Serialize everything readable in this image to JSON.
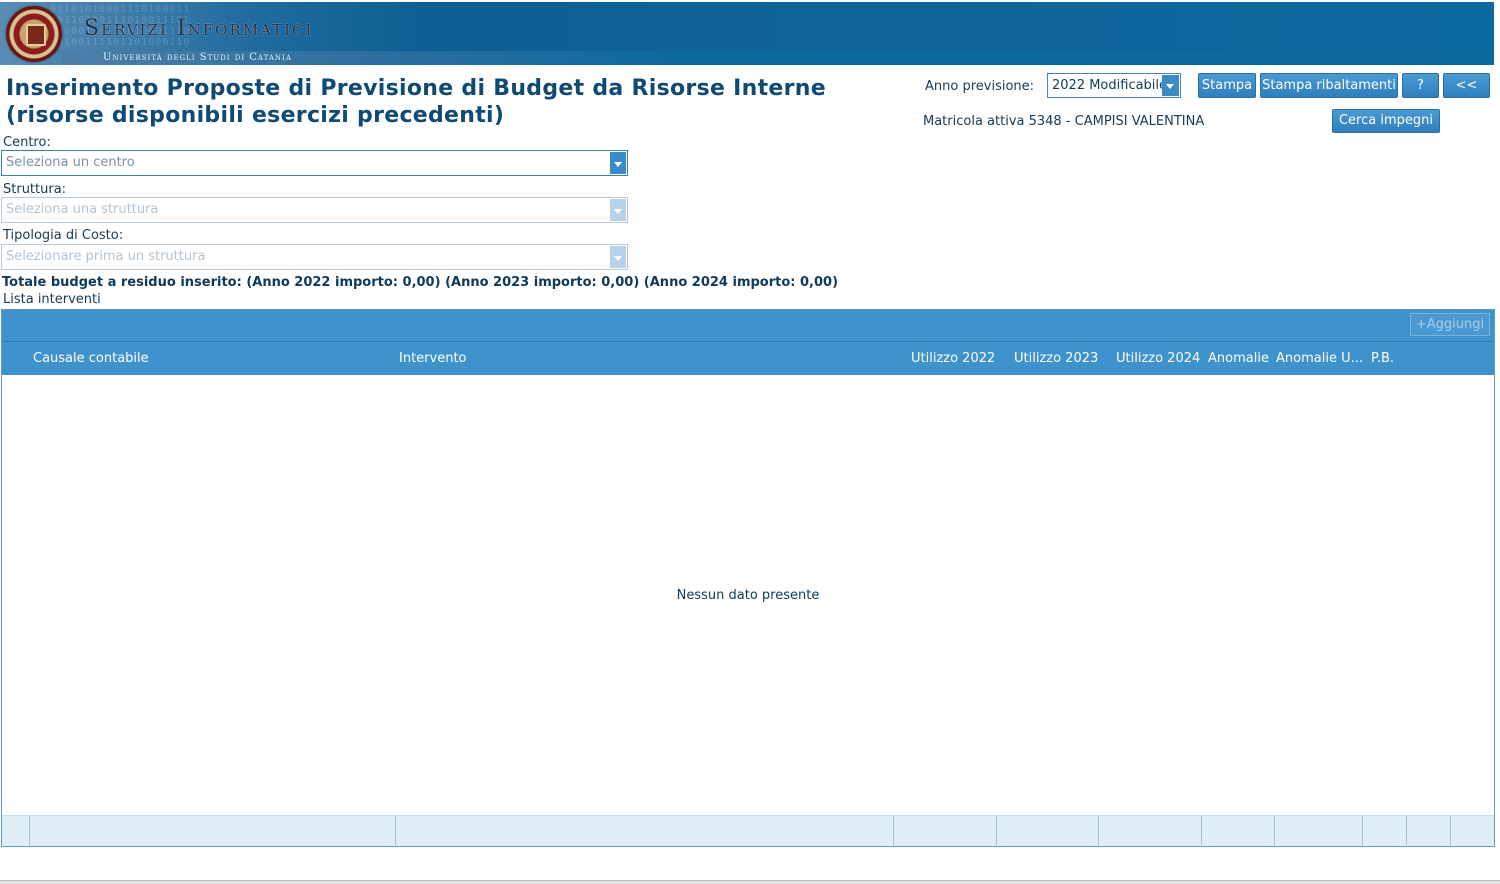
{
  "banner": {
    "title": "Servizi Informatici",
    "subtitle": "Università degli Studi di Catania",
    "logo": "university-seal"
  },
  "page": {
    "title": "Inserimento Proposte di Previsione di Budget da Risorse Interne (risorse disponibili esercizi precedenti)"
  },
  "anno": {
    "label": "Anno previsione:",
    "selected": "2022 Modificabile"
  },
  "toolbar": {
    "stampa": "Stampa",
    "stampa_ribaltamenti": "Stampa ribaltamenti",
    "help": "?",
    "back": "<<",
    "cerca_impegni": "Cerca impegni"
  },
  "matricola": "Matricola attiva 5348 - CAMPISI VALENTINA",
  "form": {
    "centro_label": "Centro:",
    "centro_placeholder": "Seleziona un centro",
    "struttura_label": "Struttura:",
    "struttura_placeholder": "Seleziona una struttura",
    "tipologia_label": "Tipologia di Costo:",
    "tipologia_placeholder": "Selezionare prima un struttura"
  },
  "totale": "Totale budget a residuo inserito: (Anno 2022 importo: 0,00) (Anno 2023 importo: 0,00) (Anno 2024 importo: 0,00)",
  "lista": {
    "label": "Lista interventi",
    "add_label": "+Aggiungi",
    "columns": [
      "Causale contabile",
      "Intervento",
      "Utilizzo 2022",
      "Utilizzo 2023",
      "Utilizzo 2024",
      "Anomalie",
      "Anomalie U...",
      "P.B."
    ],
    "empty_message": "Nessun dato presente"
  },
  "colors": {
    "accent": "#3f93cc",
    "banner": "#0d6a9f",
    "title": "#0f4a75"
  }
}
